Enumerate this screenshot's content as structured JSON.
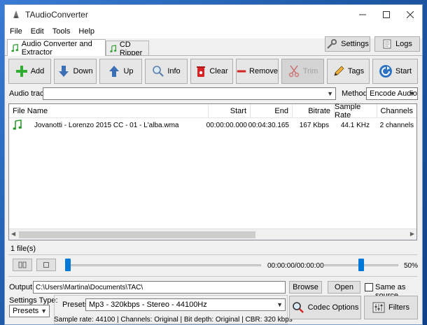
{
  "window": {
    "title": "TAudioConverter"
  },
  "menu": [
    "File",
    "Edit",
    "Tools",
    "Help"
  ],
  "tabs": [
    {
      "label": "Audio Converter and Extractor",
      "active": true
    },
    {
      "label": "CD Ripper",
      "active": false
    }
  ],
  "top_buttons": {
    "settings": "Settings",
    "logs": "Logs"
  },
  "toolbar": {
    "add": "Add",
    "down": "Down",
    "up": "Up",
    "info": "Info",
    "clear": "Clear",
    "remove": "Remove",
    "trim": "Trim",
    "tags": "Tags",
    "start": "Start"
  },
  "audio_track": {
    "label": "Audio track:",
    "value": ""
  },
  "method": {
    "label": "Method:",
    "value": "Encode Audio"
  },
  "list": {
    "columns": [
      "File Name",
      "Start",
      "End",
      "Bitrate",
      "Sample Rate",
      "Channels"
    ],
    "rows": [
      {
        "file": "Jovanotti - Lorenzo 2015 CC - 01 - L'alba.wma",
        "start": "00:00:00.000",
        "end": "00:04:30.165",
        "bitrate": "167 Kbps",
        "sample_rate": "44.1 KHz",
        "channels": "2 channels"
      }
    ]
  },
  "file_count": "1 file(s)",
  "playback": {
    "time": "00:00:00/00:00:00",
    "volume": "50%",
    "position_percent": 0,
    "volume_percent": 50
  },
  "output": {
    "label": "Output:",
    "path": "C:\\Users\\Martina\\Documents\\TAC\\",
    "browse": "Browse",
    "open": "Open",
    "same_as_source": "Same as source"
  },
  "settings_type": {
    "label": "Settings Type:",
    "value": "Presets"
  },
  "presets": {
    "label": "Presets:",
    "value": "Mp3 - 320kbps - Stereo - 44100Hz"
  },
  "codec_options": "Codec Options",
  "filters": "Filters",
  "status_line": "Sample rate: 44100 | Channels: Original | Bit depth: Original | CBR: 320 kbps",
  "colors": {
    "accent": "#0078d7",
    "list_bg": "#ffffff",
    "window_bg": "#f0f0f0"
  }
}
